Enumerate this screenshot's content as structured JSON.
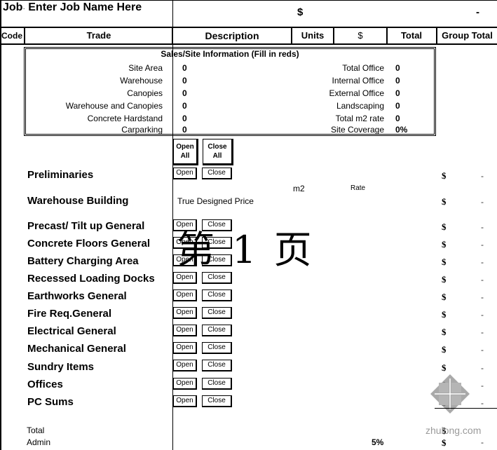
{
  "header": {
    "job_label": "Job",
    "job_name": "Enter Job Name Here",
    "currency_symbol": "$",
    "grand_total": "-"
  },
  "columns": {
    "code": "Code",
    "trade": "Trade",
    "description": "Description",
    "units": "Units",
    "dollar": "$",
    "total": "Total",
    "group_total": "Group Total"
  },
  "sales_info": {
    "title": "Sales/Site Information (Fill in reds)",
    "left": [
      {
        "label": "Site Area",
        "value": "0"
      },
      {
        "label": "Warehouse",
        "value": "0"
      },
      {
        "label": "Canopies",
        "value": "0"
      },
      {
        "label": "Warehouse and Canopies",
        "value": "0"
      },
      {
        "label": "Concrete Hardstand",
        "value": "0"
      },
      {
        "label": "Carparking",
        "value": "0"
      }
    ],
    "right": [
      {
        "label": "Total Office",
        "value": "0"
      },
      {
        "label": "Internal Office",
        "value": "0"
      },
      {
        "label": "External Office",
        "value": "0"
      },
      {
        "label": "Landscaping",
        "value": "0"
      },
      {
        "label": "Total m2 rate",
        "value": "0"
      },
      {
        "label": "Site Coverage",
        "value": "0%"
      }
    ]
  },
  "controls": {
    "open_all_line1": "Open",
    "open_all_line2": "All",
    "close_all_line1": "Close",
    "close_all_line2": "All",
    "open": "Open",
    "close": "Close"
  },
  "warehouse_building": {
    "m2_label": "m2",
    "rate_label": "Rate",
    "description": "True Designed Price"
  },
  "trades": [
    {
      "name": "Preliminaries",
      "symbol": "$",
      "group_total": "-"
    },
    {
      "name": "Warehouse Building",
      "symbol": "$",
      "group_total": "-"
    },
    {
      "name": "Precast/ Tilt up General",
      "symbol": "$",
      "group_total": "-"
    },
    {
      "name": "Concrete Floors General",
      "symbol": "$",
      "group_total": "-"
    },
    {
      "name": "Battery Charging Area",
      "symbol": "$",
      "group_total": "-"
    },
    {
      "name": "Recessed Loading Docks",
      "symbol": "$",
      "group_total": "-"
    },
    {
      "name": "Earthworks General",
      "symbol": "$",
      "group_total": "-"
    },
    {
      "name": "Fire Req.General",
      "symbol": "$",
      "group_total": "-"
    },
    {
      "name": "Electrical General",
      "symbol": "$",
      "group_total": "-"
    },
    {
      "name": "Mechanical General",
      "symbol": "$",
      "group_total": "-"
    },
    {
      "name": "Sundry Items",
      "symbol": "$",
      "group_total": "-"
    },
    {
      "name": "Offices",
      "symbol": "$",
      "group_total": "-"
    },
    {
      "name": "PC Sums",
      "symbol": "$",
      "group_total": "-"
    }
  ],
  "summary": [
    {
      "label": "Total",
      "percent": "",
      "symbol": "$",
      "value": ""
    },
    {
      "label": "Admin",
      "percent": "5%",
      "symbol": "$",
      "value": "-"
    }
  ],
  "watermark": {
    "page_text": "第 1 页",
    "site": "zhulong.com"
  }
}
